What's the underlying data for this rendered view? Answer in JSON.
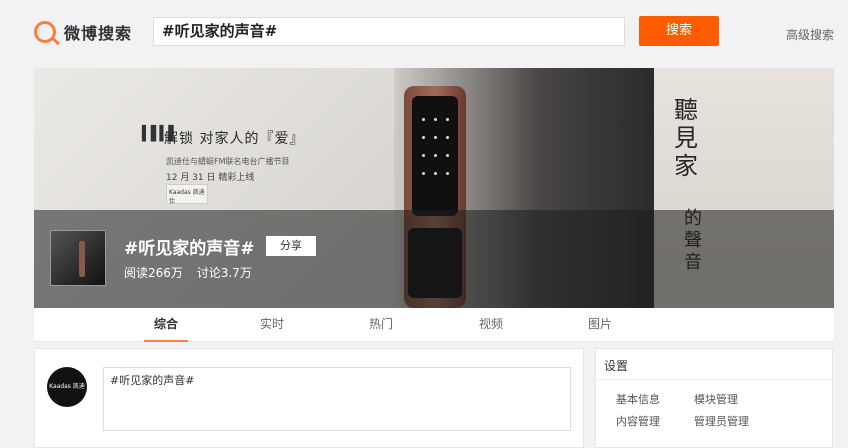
{
  "header": {
    "logo_text": "微博搜索",
    "search_value": "#听见家的声音#",
    "search_button": "搜索",
    "advanced_search": "高级搜索"
  },
  "banner": {
    "slogan": "解锁 对家人的『爱』",
    "sub_line1": "凯迪仕与蜻蜓FM联名电台广播节目",
    "sub_line2": "12 月 31 日 精彩上线",
    "tag_text": "Kaadas 凯迪仕",
    "vertical_title": [
      "聽",
      "見",
      "家"
    ],
    "vertical_small": [
      "的",
      "聲",
      "音"
    ]
  },
  "topic": {
    "title": "#听见家的声音#",
    "share_label": "分享",
    "reads": "阅读266万",
    "discussions": "讨论3.7万"
  },
  "tabs": [
    {
      "label": "综合",
      "active": true
    },
    {
      "label": "实时",
      "active": false
    },
    {
      "label": "热门",
      "active": false
    },
    {
      "label": "视频",
      "active": false
    },
    {
      "label": "图片",
      "active": false
    }
  ],
  "post": {
    "avatar_text": "Kaadas 凯迪仕",
    "input_value": "#听见家的声音#"
  },
  "settings": {
    "title": "设置",
    "links": [
      "基本信息",
      "模块管理",
      "内容管理",
      "管理员管理"
    ]
  },
  "colors": {
    "accent": "#ff5c00",
    "tab_underline": "#ff8140"
  }
}
